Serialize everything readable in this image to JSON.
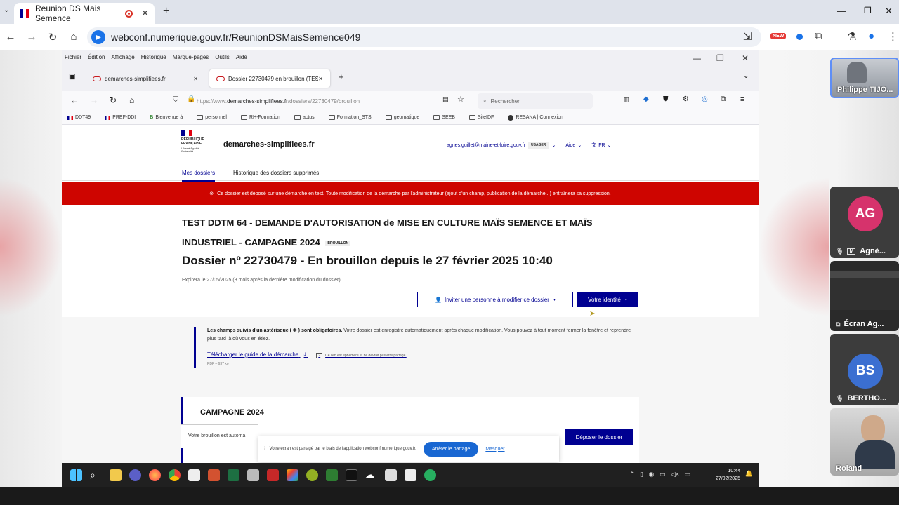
{
  "chrome": {
    "tab_title": "Reunion DS Mais Semence",
    "url": "webconf.numerique.gouv.fr/ReunionDSMaisSemence049",
    "new_badge": "NEW"
  },
  "firefox": {
    "menu": [
      "Fichier",
      "Édition",
      "Affichage",
      "Historique",
      "Marque-pages",
      "Outils",
      "Aide"
    ],
    "tabs": [
      {
        "label": "demarches-simplifiees.fr"
      },
      {
        "label": "Dossier 22730479 en brouillon (TEST"
      }
    ],
    "url_prefix": "https://www.",
    "url_domain": "demarches-simplifiees.fr",
    "url_path": "/dossiers/22730479/brouillon",
    "search_placeholder": "Rechercher",
    "bookmarks": [
      "DDT49",
      "PREF-DDI",
      "Bienvenue à",
      "personnel",
      "RH-Formation",
      "actus",
      "Formation_STS",
      "geomatique",
      "SEEB",
      "SiteIDF",
      "RESANA | Connexion"
    ]
  },
  "ds": {
    "marianne_lines": [
      "RÉPUBLIQUE",
      "FRANÇAISE"
    ],
    "devise": "Liberté Égalité Fraternité",
    "brand": "demarches-simplifiees.fr",
    "user_email": "agnes.guillet@maine-et-loire.gouv.fr",
    "user_role": "USAGER",
    "aide": "Aide",
    "lang": "FR",
    "tabs": [
      "Mes dossiers",
      "Historique des dossiers supprimés"
    ],
    "alert": "Ce dossier est déposé sur une démarche en test. Toute modification de la démarche par l'administrateur (ajout d'un champ, publication de la démarche...) entraînera sa suppression.",
    "title_line1": "TEST DDTM 64 - DEMANDE D'AUTORISATION de MISE EN CULTURE MAÏS SEMENCE ET MAÏS",
    "title_line2": "INDUSTRIEL - CAMPAGNE 2024",
    "brouillon_badge": "BROUILLON",
    "dossier_heading": "Dossier nº 22730479 - En brouillon depuis le 27 février 2025 10:40",
    "expire": "Expirera le 27/05/2025 (3 mois après la dernière modification du dossier)",
    "invite_button": "Inviter une personne à modifier ce dossier",
    "identity_button": "Votre identité",
    "info_bold": "Les champs suivis d'un astérisque ( ✱ ) sont obligatoires.",
    "info_text": "Votre dossier est enregistré automatiquement après chaque modification. Vous pouvez à tout moment fermer la fenêtre et reprendre plus tard là où vous en étiez.",
    "guide_link": "Télécharger le guide de la démarche",
    "guide_note": "Ce lien est éphémère et ne devrait pas être partagé.",
    "pdf_info": "PDF – 637 ko",
    "section_title": "CAMPAGNE 2024",
    "draft_strip": "Votre brouillon est automa",
    "deposit_button": "Déposer le dossier"
  },
  "share": {
    "message": "Votre écran est partagé par le biais de l'application webconf.numerique.gouv.fr.",
    "stop_button": "Arrêter le partage",
    "hide_link": "Masquer"
  },
  "taskbar": {
    "time": "10:44",
    "date": "27/02/2025"
  },
  "participants": [
    {
      "name": "Philippe TIJO...",
      "type": "video"
    },
    {
      "initials": "AG",
      "name": "Agnè...",
      "color": "#d6336c",
      "type": "avatar"
    },
    {
      "name": "Écran Ag...",
      "type": "screen"
    },
    {
      "initials": "BS",
      "name": "BERTHO...",
      "color": "#3b6fd1",
      "type": "avatar"
    },
    {
      "name": "Roland",
      "type": "video"
    }
  ]
}
